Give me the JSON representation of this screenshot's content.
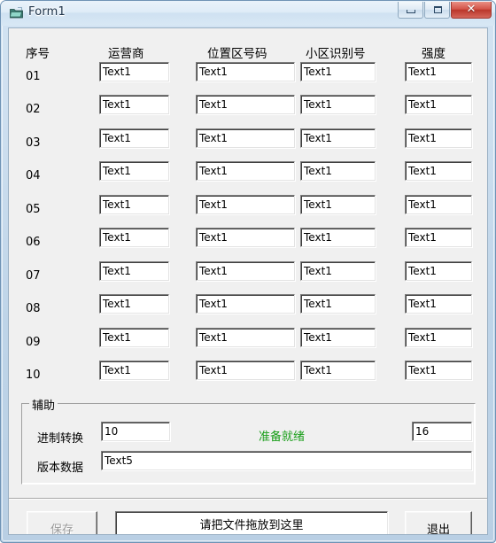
{
  "window": {
    "title": "Form1",
    "icon": "folder-icon",
    "controls": {
      "minimize": "minimize-icon",
      "maximize": "maximize-icon",
      "close_glyph": "✕"
    }
  },
  "table": {
    "headers": [
      "序号",
      "运营商",
      "位置区号码",
      "小区识别号",
      "强度"
    ],
    "rows": [
      {
        "index": "01",
        "operator": "Text1",
        "lac": "Text1",
        "cellid": "Text1",
        "strength": "Text1"
      },
      {
        "index": "02",
        "operator": "Text1",
        "lac": "Text1",
        "cellid": "Text1",
        "strength": "Text1"
      },
      {
        "index": "03",
        "operator": "Text1",
        "lac": "Text1",
        "cellid": "Text1",
        "strength": "Text1"
      },
      {
        "index": "04",
        "operator": "Text1",
        "lac": "Text1",
        "cellid": "Text1",
        "strength": "Text1"
      },
      {
        "index": "05",
        "operator": "Text1",
        "lac": "Text1",
        "cellid": "Text1",
        "strength": "Text1"
      },
      {
        "index": "06",
        "operator": "Text1",
        "lac": "Text1",
        "cellid": "Text1",
        "strength": "Text1"
      },
      {
        "index": "07",
        "operator": "Text1",
        "lac": "Text1",
        "cellid": "Text1",
        "strength": "Text1"
      },
      {
        "index": "08",
        "operator": "Text1",
        "lac": "Text1",
        "cellid": "Text1",
        "strength": "Text1"
      },
      {
        "index": "09",
        "operator": "Text1",
        "lac": "Text1",
        "cellid": "Text1",
        "strength": "Text1"
      },
      {
        "index": "10",
        "operator": "Text1",
        "lac": "Text1",
        "cellid": "Text1",
        "strength": "Text1"
      }
    ]
  },
  "aux": {
    "group_title": "辅助",
    "radix_label": "进制转换",
    "radix_from_value": "10",
    "radix_to_value": "16",
    "status_text": "准备就绪",
    "status_color": "#1a9e1a",
    "version_label": "版本数据",
    "version_value": "Text5"
  },
  "footer": {
    "save_label": "保存",
    "save_enabled": false,
    "drop_hint": "请把文件拖放到这里",
    "exit_label": "退出"
  }
}
